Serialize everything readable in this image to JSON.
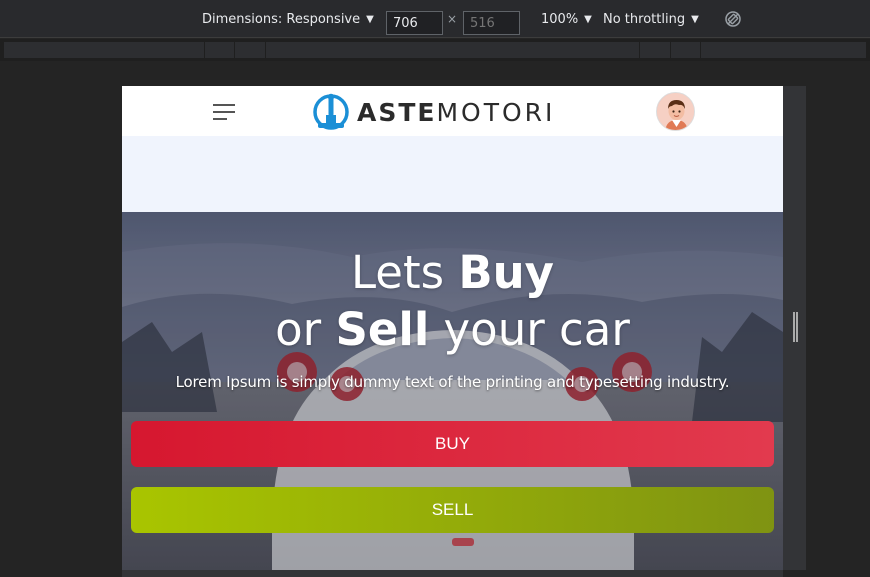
{
  "devtools": {
    "dimensions_label": "Dimensions: Responsive",
    "width_value": "706",
    "height_placeholder": "516",
    "times": "×",
    "zoom": "100%",
    "throttling": "No throttling",
    "caret": "▼",
    "rotate_icon": "rotate-disabled-icon"
  },
  "site": {
    "logo_bold": "ASTE",
    "logo_light": "MOTORI",
    "brand_color": "#1b8fd6",
    "hero": {
      "line1_regular": "Lets ",
      "line1_bold": "Buy",
      "line2_regular_a": "or ",
      "line2_bold": "Sell",
      "line2_regular_b": " your car",
      "subtitle": "Lorem Ipsum is simply dummy text of the printing and typesetting industry."
    },
    "buttons": {
      "buy_label": "BUY",
      "buy_color": "#d6172f",
      "sell_label": "SELL",
      "sell_color": "#9ab300"
    }
  }
}
